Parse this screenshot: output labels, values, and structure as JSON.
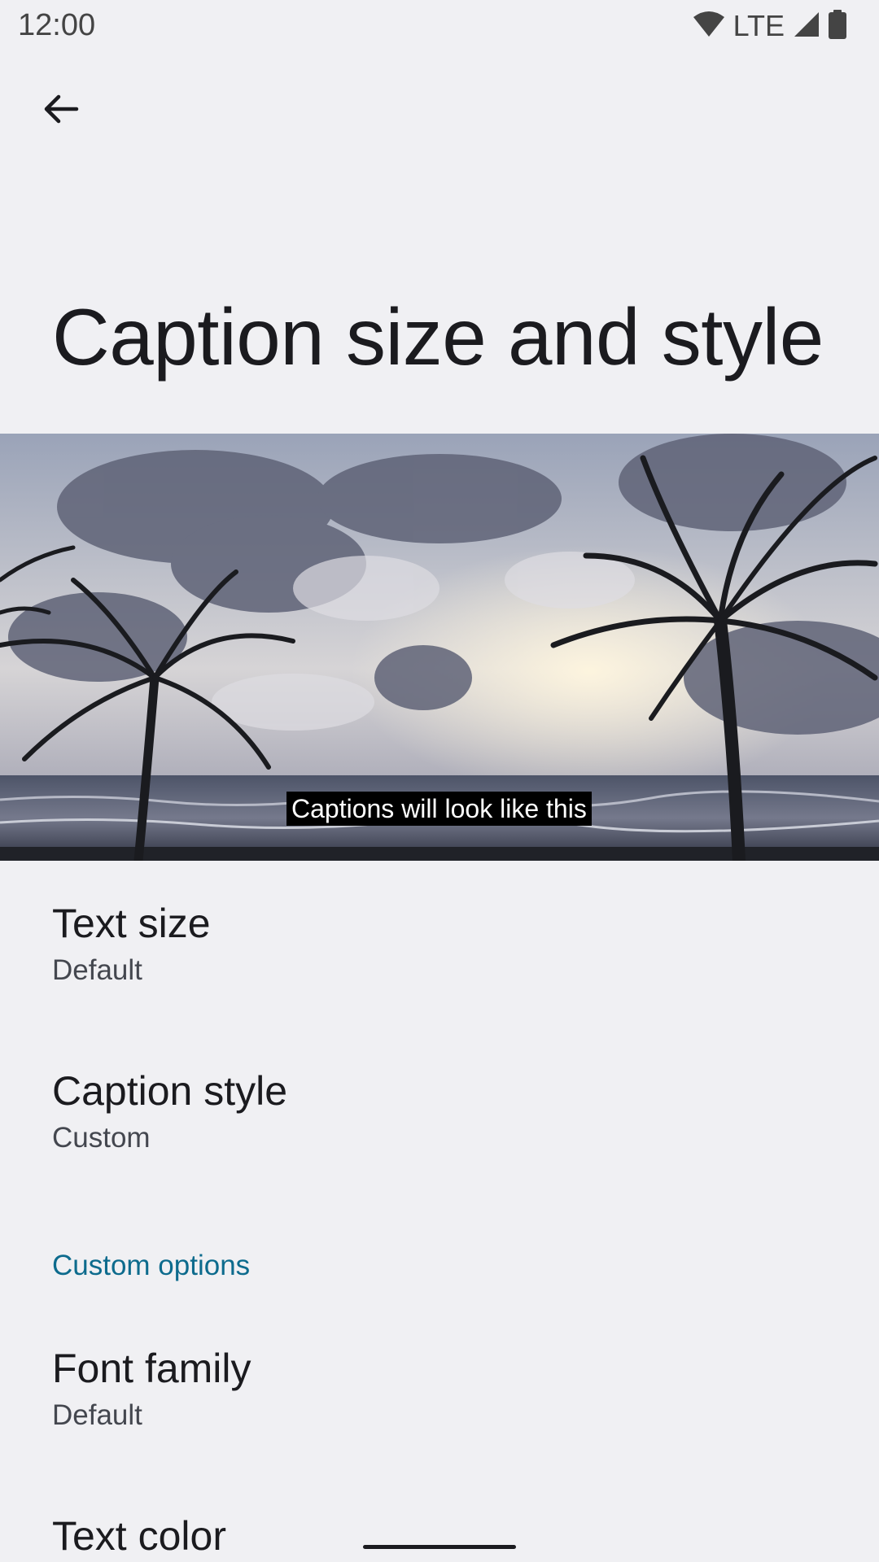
{
  "status_bar": {
    "time": "12:00",
    "network": "LTE",
    "icons": [
      "wifi-icon",
      "cellular-signal-icon",
      "battery-icon"
    ]
  },
  "toolbar": {
    "back_icon": "arrow-back-icon"
  },
  "page": {
    "title": "Caption size and style"
  },
  "preview": {
    "caption_text": "Captions will look like this"
  },
  "preferences": [
    {
      "title": "Text size",
      "summary": "Default"
    },
    {
      "title": "Caption style",
      "summary": "Custom"
    }
  ],
  "custom_options": {
    "header": "Custom options",
    "items": [
      {
        "title": "Font family",
        "summary": "Default"
      },
      {
        "title": "Text color"
      }
    ]
  },
  "colors": {
    "background": "#f0f0f3",
    "accent": "#0d6b8d",
    "caption_background": "#000000",
    "caption_text": "#ffffff"
  }
}
